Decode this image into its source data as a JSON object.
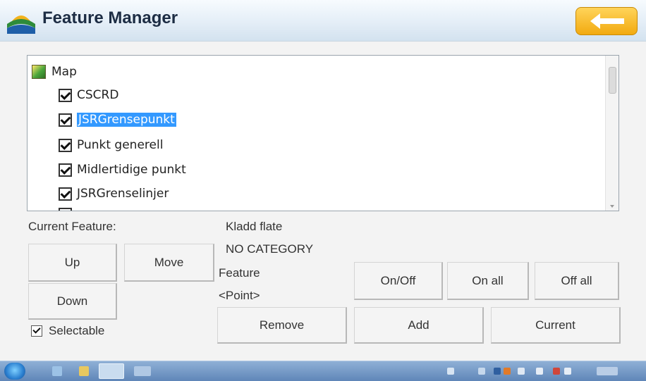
{
  "window": {
    "title": "Feature Manager"
  },
  "icons": {
    "app": "app-logo-icon",
    "back": "back-arrow-icon",
    "root": "map-folder-icon"
  },
  "colors": {
    "accent": "#f2aa10",
    "selection": "#3399ff",
    "titlebar": "#dfeaf4"
  },
  "tree": {
    "root_label": "Map",
    "items": [
      {
        "label": "CSCRD",
        "checked": true,
        "selected": false
      },
      {
        "label": "JSRGrensepunkt",
        "checked": true,
        "selected": true
      },
      {
        "label": "Punkt generell",
        "checked": true,
        "selected": false
      },
      {
        "label": "Midlertidige punkt",
        "checked": true,
        "selected": false
      },
      {
        "label": "JSRGrenselinjer",
        "checked": true,
        "selected": false
      }
    ]
  },
  "current_feature": {
    "heading": "Current Feature:",
    "name": "Kladd flate",
    "category": "NO CATEGORY",
    "type_label": "Feature",
    "type_value": "<Point>"
  },
  "buttons": {
    "up": "Up",
    "move": "Move",
    "down": "Down",
    "onoff": "On/Off",
    "on_all": "On all",
    "off_all": "Off all",
    "remove": "Remove",
    "add": "Add",
    "current": "Current"
  },
  "selectable": {
    "label": "Selectable",
    "checked": true
  }
}
